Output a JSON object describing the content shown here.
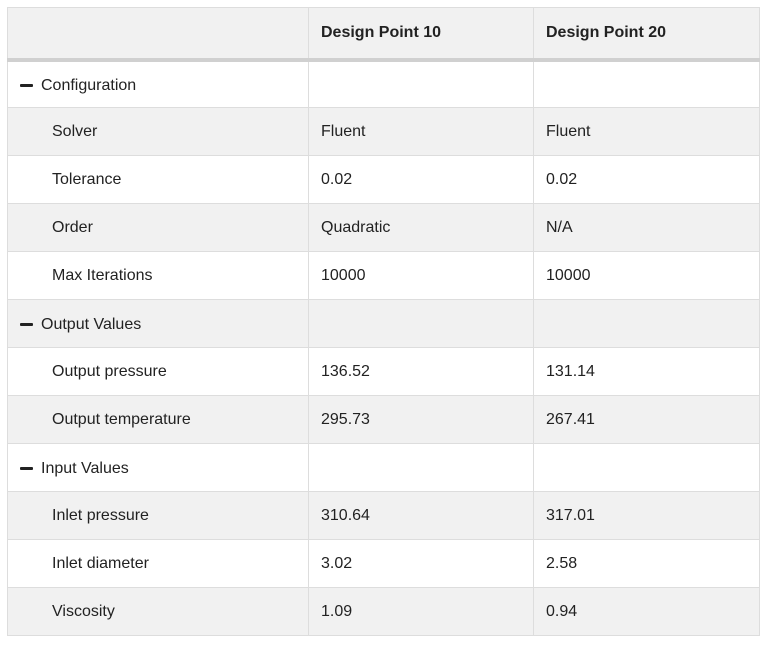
{
  "header": {
    "corner": "",
    "columns": [
      "Design Point 10",
      "Design Point 20"
    ]
  },
  "groups": [
    {
      "label": "Configuration",
      "icon": "minus-icon",
      "rows": [
        {
          "label": "Solver",
          "values": [
            "Fluent",
            "Fluent"
          ]
        },
        {
          "label": "Tolerance",
          "values": [
            "0.02",
            "0.02"
          ]
        },
        {
          "label": "Order",
          "values": [
            "Quadratic",
            "N/A"
          ]
        },
        {
          "label": "Max Iterations",
          "values": [
            "10000",
            "10000"
          ]
        }
      ]
    },
    {
      "label": "Output Values",
      "icon": "minus-icon",
      "rows": [
        {
          "label": "Output pressure",
          "values": [
            "136.52",
            "131.14"
          ]
        },
        {
          "label": "Output temperature",
          "values": [
            "295.73",
            "267.41"
          ]
        }
      ]
    },
    {
      "label": "Input Values",
      "icon": "minus-icon",
      "rows": [
        {
          "label": "Inlet pressure",
          "values": [
            "310.64",
            "317.01"
          ]
        },
        {
          "label": "Inlet diameter",
          "values": [
            "3.02",
            "2.58"
          ]
        },
        {
          "label": "Viscosity",
          "values": [
            "1.09",
            "0.94"
          ]
        }
      ]
    }
  ],
  "colors": {
    "header_bg": "#f1f1f1",
    "stripe_bg": "#f1f1f1",
    "border": "#dddddd",
    "text": "#222222"
  }
}
